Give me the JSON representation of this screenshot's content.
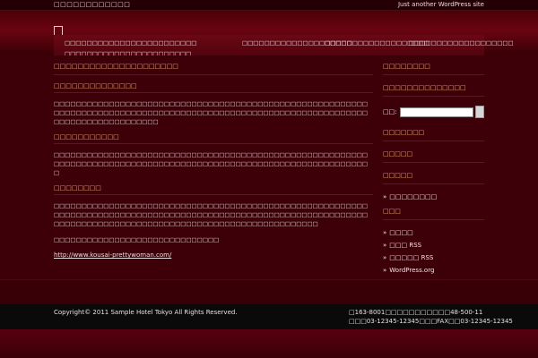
{
  "topbar": {
    "site_title": "□□□□□□□□□□□□",
    "tagline": "Just another WordPress site"
  },
  "nav": {
    "items": [
      "□□□□□□□□□□□□□□□□□□□□□□□□",
      "□□□□□□□□□□□□□□□□□□□□",
      "□□□□□□□□□□□□□□□□□□□",
      "□□□□□□□□□□□□□□□□□□□",
      "□□□□□□□□□□□□□□□□□□□□□□□"
    ]
  },
  "content": {
    "page_heading": "□□□□□□□□□□□□□□□□□□□□□",
    "sections": [
      {
        "title": "□□□□□□□□□□□□□□",
        "text": "□□□□□□□□□□□□□□□□□□□□□□□□□□□□□□□□□□□□□□□□□□□□□□□□□□□□□□□□□□□□□□□□□□□□□□□□□□□□□□□□□□□□□□□□□□□□□□□□□□□□□□□□□□□□□□□□□□□□□□□□□□□□□□□□□□□□□"
      },
      {
        "title": "□□□□□□□□□□□",
        "text": "□□□□□□□□□□□□□□□□□□□□□□□□□□□□□□□□□□□□□□□□□□□□□□□□□□□□□□□□□□□□□□□□□□□□□□□□□□□□□□□□□□□□□□□□□□□□□□□□□□□□□□□□□□□□□□□□□□□"
      },
      {
        "title": "□□□□□□□□",
        "text": "□□□□□□□□□□□□□□□□□□□□□□□□□□□□□□□□□□□□□□□□□□□□□□□□□□□□□□□□□□□□□□□□□□□□□□□□□□□□□□□□□□□□□□□□□□□□□□□□□□□□□□□□□□□□□□□□□□□□□□□□□□□□□□□□□□□□□□□□□□□□□□□□□□□□□□□□□□□□□□□□□□"
      }
    ],
    "extra_text": "□□□□□□□□□□□□□□□□□□□□□□□□□□□□□□",
    "link_text": "http://www.kousai-prettywoman.com/"
  },
  "sidebar": {
    "heading_1": "□□□□□□□□",
    "heading_2": "□□□□□□□□□□□□□□",
    "search_label": "□□:",
    "search_placeholder": "",
    "heading_3": "□□□□□□□",
    "heading_4": "□□□□□",
    "heading_5": "□□□□□",
    "list_1": [
      "□□□□□□□□"
    ],
    "heading_6": "□□□",
    "list_2": [
      "□□□□",
      "□□□ RSS",
      "□□□□□ RSS",
      "WordPress.org"
    ]
  },
  "footer": {
    "copyright": "Copyright© 2011 Sample Hotel Tokyo All Rights Reserved.",
    "address_line_1": "□163-8001□□□□□□□□□□□48-500-11",
    "address_line_2": "□□□03-12345-12345□□□FAX□□03-12345-12345"
  },
  "colors": {
    "background": "#3a0006",
    "heading": "#f0b060",
    "footer": "#0a0a0a"
  }
}
